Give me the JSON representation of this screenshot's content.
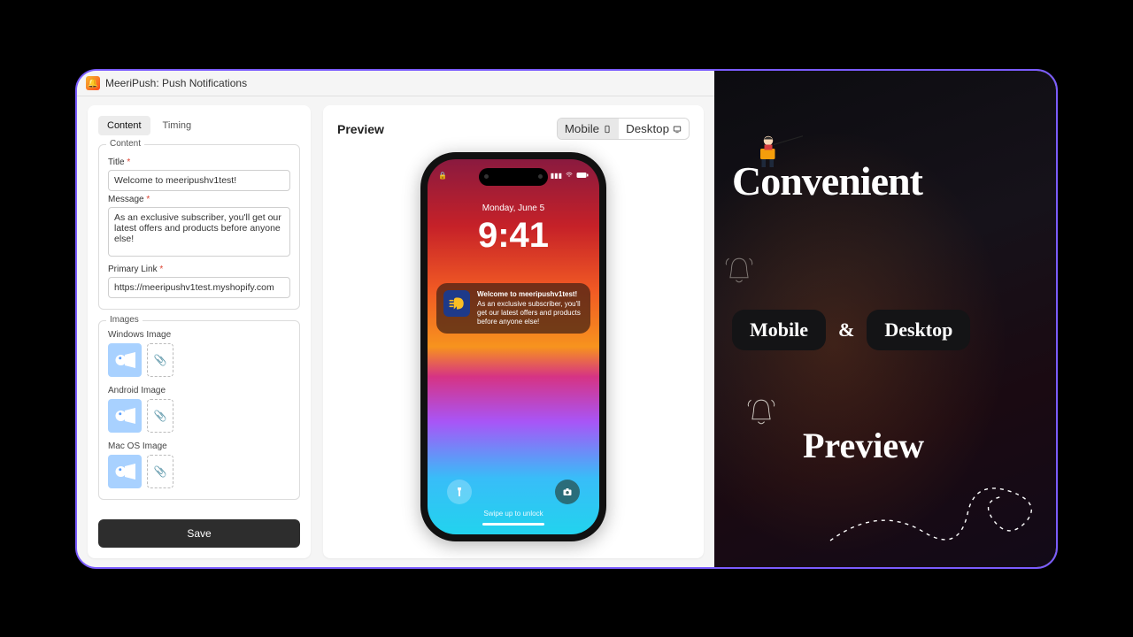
{
  "app": {
    "title": "MeeriPush: Push Notifications"
  },
  "tabs": {
    "content": "Content",
    "timing": "Timing"
  },
  "form": {
    "content_legend": "Content",
    "title_label": "Title",
    "title_value": "Welcome to meeripushv1test!",
    "message_label": "Message",
    "message_value": "As an exclusive subscriber, you'll get our latest offers and products before anyone else!",
    "link_label": "Primary Link",
    "link_value": "https://meeripushv1test.myshopify.com",
    "images_legend": "Images",
    "windows_label": "Windows Image",
    "android_label": "Android Image",
    "macos_label": "Mac OS Image",
    "save": "Save"
  },
  "preview": {
    "title": "Preview",
    "mobile": "Mobile",
    "desktop": "Desktop",
    "lock_date": "Monday, June 5",
    "lock_time": "9:41",
    "notif_title": "Welcome to meeripushv1test!",
    "notif_body": "As an exclusive subscriber, you'll get our latest offers and products before anyone else!",
    "swipe": "Swipe up to unlock",
    "lock_icon": "🔒"
  },
  "marketing": {
    "headline": "Convenient",
    "pill_mobile": "Mobile",
    "amp": "&",
    "pill_desktop": "Desktop",
    "preview": "Preview"
  }
}
